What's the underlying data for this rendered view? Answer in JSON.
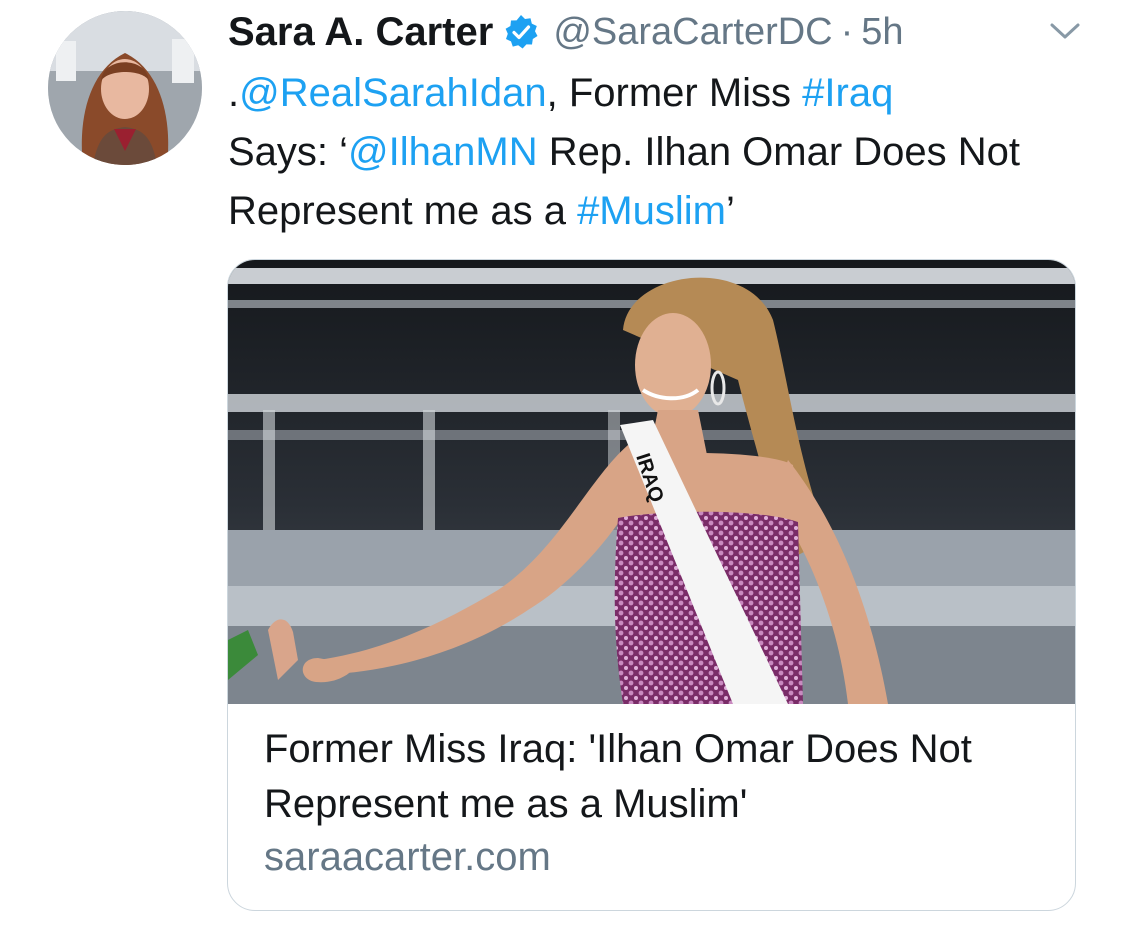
{
  "tweet": {
    "author": {
      "display_name": "Sara A. Carter",
      "handle": "@SaraCarterDC",
      "verified_icon": "verified-badge-icon"
    },
    "separator": "·",
    "timestamp": "5h",
    "menu_icon": "chevron-down-icon",
    "text": {
      "prefix": ".",
      "mention_1": "@RealSarahIdan",
      "part_1": ", Former Miss ",
      "hashtag_1": "#Iraq",
      "part_2": " Says: ‘",
      "mention_2": "@IlhanMN",
      "part_3": " Rep. Ilhan Omar Does Not Represent me as a ",
      "hashtag_2": "#Muslim",
      "suffix": "’"
    },
    "card": {
      "sash_text": "IRAQ",
      "title": "Former Miss Iraq: 'Ilhan Omar Does Not Represent me as a Muslim'",
      "domain": "saraacarter.com"
    }
  },
  "colors": {
    "link": "#1da1f2",
    "verified": "#1da1f2",
    "secondary_text": "#657786",
    "primary_text": "#14171a",
    "card_border": "#ccd6dd"
  }
}
